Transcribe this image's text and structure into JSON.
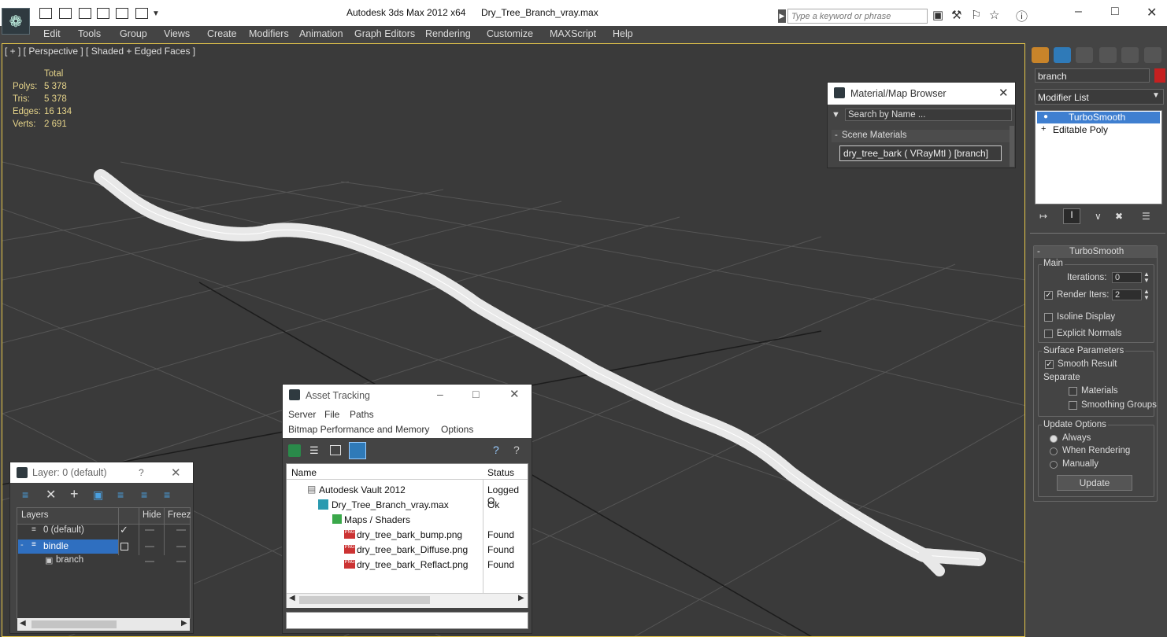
{
  "title_bar": {
    "app_title": "Autodesk 3ds Max  2012 x64",
    "file_title": "Dry_Tree_Branch_vray.max",
    "search_placeholder": "Type a keyword or phrase"
  },
  "menu": [
    "Edit",
    "Tools",
    "Group",
    "Views",
    "Create",
    "Modifiers",
    "Animation",
    "Graph Editors",
    "Rendering",
    "Customize",
    "MAXScript",
    "Help"
  ],
  "viewport": {
    "label": "[ + ] [ Perspective ] [ Shaded + Edged Faces ]",
    "stats": {
      "header": "Total",
      "rows": [
        {
          "label": "Polys:",
          "value": "5 378"
        },
        {
          "label": "Tris:",
          "value": "5 378"
        },
        {
          "label": "Edges:",
          "value": "16 134"
        },
        {
          "label": "Verts:",
          "value": "2 691"
        }
      ]
    }
  },
  "command_panel": {
    "object_name": "branch",
    "modifier_list": "Modifier List",
    "stack": [
      "TurboSmooth",
      "Editable Poly"
    ],
    "rollout_title": "TurboSmooth",
    "main": {
      "title": "Main",
      "iterations_label": "Iterations:",
      "iterations_value": "0",
      "render_iters_label": "Render Iters:",
      "render_iters_value": "2",
      "isoline_label": "Isoline Display",
      "explicit_normals_label": "Explicit Normals"
    },
    "surface": {
      "title": "Surface Parameters",
      "smooth_result_label": "Smooth Result",
      "separate_label": "Separate",
      "materials_label": "Materials",
      "smoothing_groups_label": "Smoothing Groups"
    },
    "update": {
      "title": "Update Options",
      "always_label": "Always",
      "when_rendering_label": "When Rendering",
      "manually_label": "Manually",
      "update_button": "Update"
    }
  },
  "material_browser": {
    "title": "Material/Map Browser",
    "search_placeholder": "Search by Name ...",
    "section": "Scene Materials",
    "item": "dry_tree_bark  ( VRayMtl ) [branch]"
  },
  "asset_tracking": {
    "title": "Asset Tracking",
    "menu1": [
      "Server",
      "File",
      "Paths"
    ],
    "menu2": [
      "Bitmap Performance and Memory",
      "Options"
    ],
    "columns": [
      "Name",
      "Status"
    ],
    "rows": [
      {
        "name": "Autodesk Vault 2012",
        "status": "Logged O"
      },
      {
        "name": "Dry_Tree_Branch_vray.max",
        "status": "Ok"
      },
      {
        "name": "Maps / Shaders",
        "status": ""
      },
      {
        "name": "dry_tree_bark_bump.png",
        "status": "Found"
      },
      {
        "name": "dry_tree_bark_Diffuse.png",
        "status": "Found"
      },
      {
        "name": "dry_tree_bark_Reflact.png",
        "status": "Found"
      }
    ]
  },
  "layer_window": {
    "title": "Layer: 0 (default)",
    "help": "?",
    "columns": [
      "Layers",
      "Hide",
      "Freez"
    ],
    "rows": [
      "0 (default)",
      "bindle",
      "branch"
    ]
  }
}
